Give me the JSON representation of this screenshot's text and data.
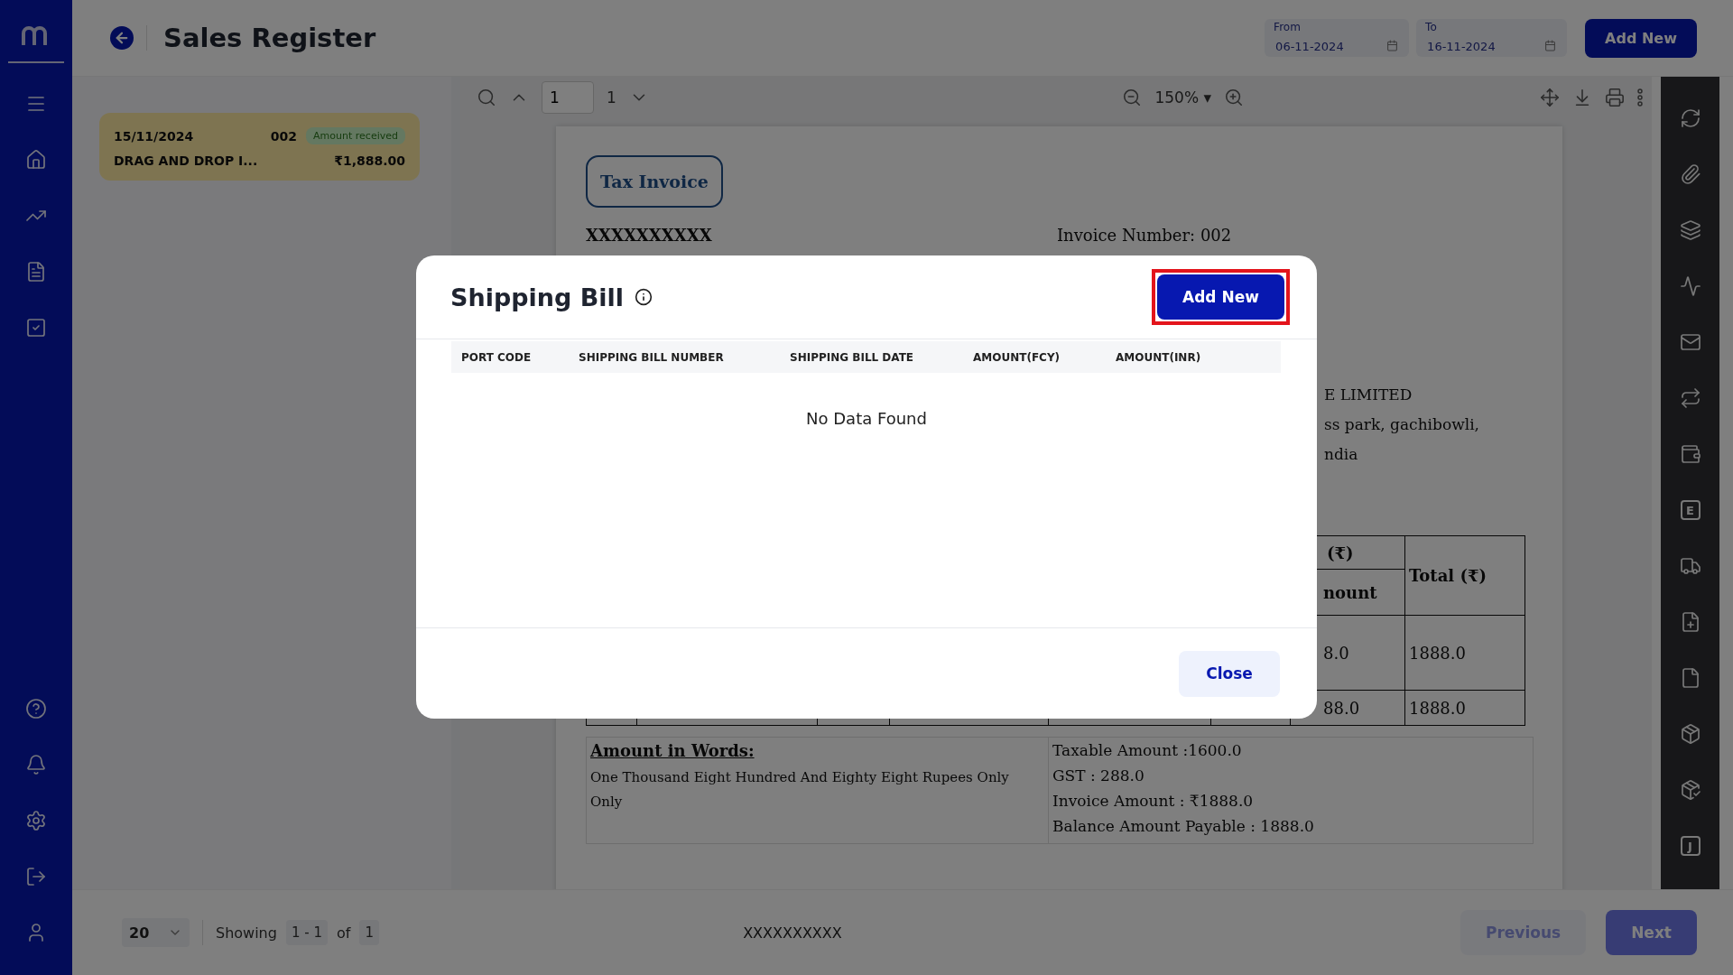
{
  "header": {
    "title": "Sales Register",
    "date_from": {
      "label": "From",
      "value": "06-11-2024"
    },
    "date_to": {
      "label": "To",
      "value": "16-11-2024"
    },
    "add_button": "Add New"
  },
  "records": [
    {
      "date": "15/11/2024",
      "number": "002",
      "status": "Amount received",
      "name": "DRAG AND DROP I...",
      "amount": "₹1,888.00",
      "selected": true
    }
  ],
  "viewer": {
    "page": "1",
    "page_count": "1",
    "zoom": "150%",
    "zoom_caret": "▾"
  },
  "invoice": {
    "badge": "Tax Invoice",
    "company": "XXXXXXXXXX",
    "invoice_number": "Invoice Number: 002",
    "address_lines": [
      "E LIMITED",
      "ss park, gachibowli,",
      "ndia"
    ],
    "table": {
      "header_top": "(₹)",
      "header_sub": "nount",
      "header_total": "Total (₹)",
      "row_amount": "8.0",
      "row_total": "1888.0",
      "sum_amount": "88.0",
      "sum_total": "1888.0"
    },
    "words_title": "Amount in Words:",
    "words_text": "One Thousand Eight Hundred And Eighty Eight Rupees Only Only",
    "summary": [
      "Taxable Amount :1600.0",
      "GST : 288.0",
      "Invoice Amount : ₹1888.0",
      "Balance Amount Payable : 1888.0"
    ]
  },
  "right_rail_letters": [
    "E",
    "J"
  ],
  "pagination": {
    "page_size": "20",
    "showing_label": "Showing",
    "range": "1 - 1",
    "of_label": "of",
    "total": "1",
    "center_text": "XXXXXXXXXX",
    "previous": {
      "label": "Previous",
      "disabled": true
    },
    "next": {
      "label": "Next",
      "disabled": false
    }
  },
  "modal": {
    "title": "Shipping Bill",
    "add_button": "Add New",
    "columns": [
      "PORT CODE",
      "SHIPPING BILL NUMBER",
      "SHIPPING BILL DATE",
      "AMOUNT(FCY)",
      "AMOUNT(INR)"
    ],
    "empty_text": "No Data Found",
    "close_button": "Close"
  }
}
